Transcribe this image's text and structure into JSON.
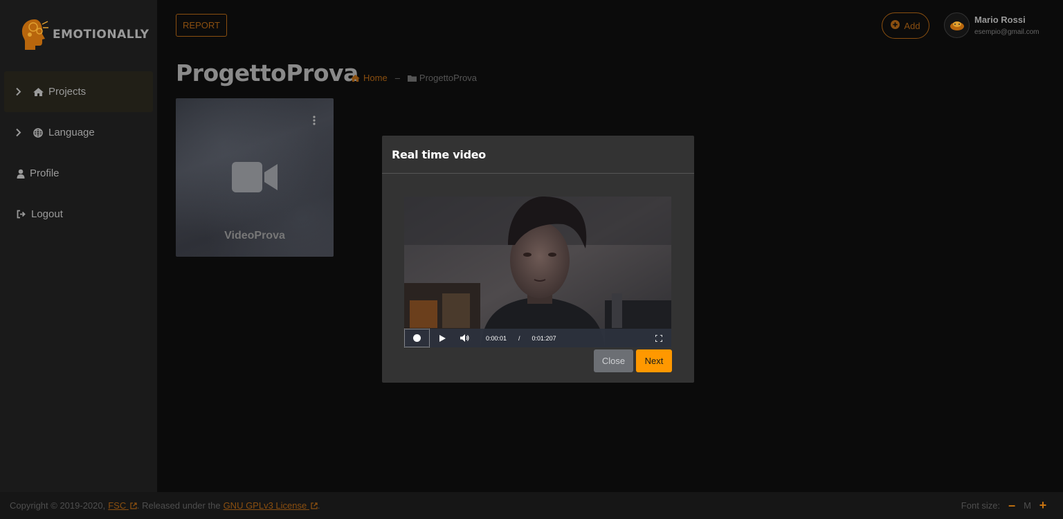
{
  "app": {
    "name": "EMOTIONALLY"
  },
  "sidebar": {
    "items": [
      {
        "label": "Projects",
        "icon": "home-icon",
        "expandable": true,
        "active": true
      },
      {
        "label": "Language",
        "icon": "globe-icon",
        "expandable": true,
        "active": false
      },
      {
        "label": "Profile",
        "icon": "user-icon",
        "expandable": false,
        "active": false
      },
      {
        "label": "Logout",
        "icon": "sign-out-icon",
        "expandable": false,
        "active": false
      }
    ]
  },
  "header": {
    "report_label": "REPORT",
    "add_label": "Add",
    "user": {
      "name": "Mario Rossi",
      "email": "esempio@gmail.com"
    }
  },
  "page": {
    "title": "ProgettoProva",
    "breadcrumb": {
      "home": "Home",
      "separator": "–",
      "current": "ProgettoProva"
    }
  },
  "cards": [
    {
      "title": "VideoProva",
      "icon": "video-camera-icon"
    }
  ],
  "modal": {
    "title": "Real time video",
    "player": {
      "current_time": "0:00:01",
      "divider": "/",
      "duration": "0:01:207"
    },
    "close_label": "Close",
    "next_label": "Next"
  },
  "footer": {
    "copyright": "Copyright © 2019-2020,",
    "org_link": "FSC",
    "released_text": ". Released under the",
    "license_link": "GNU GPLv3 License",
    "end_text": ".",
    "font_size_label": "Font size:",
    "font_size_value": "M",
    "decrease_label": "–",
    "increase_label": "+"
  },
  "colors": {
    "accent": "#ff9800",
    "accent_dim": "#8a4f10",
    "background": "#0b0b0b",
    "sidebar": "#1a1a1a",
    "modal": "#333333"
  }
}
